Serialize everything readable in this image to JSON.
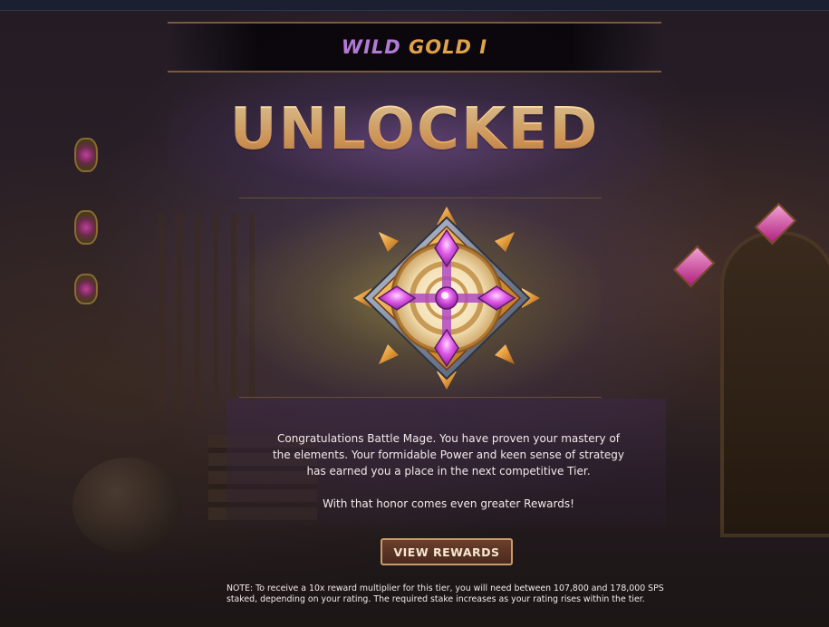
{
  "tier": {
    "league": "WILD",
    "rank": "GOLD I"
  },
  "unlock_title": "UNLOCKED",
  "message": {
    "paragraph1": "Congratulations Battle Mage. You have proven your mastery of the elements. Your formidable Power and keen sense of strategy has earned you a place in the next competitive Tier.",
    "paragraph2": "With that honor comes even greater Rewards!"
  },
  "view_rewards_label": "VIEW REWARDS",
  "note": "NOTE: To receive a 10x reward multiplier for this tier, you will need between 107,800 and 178,000 SPS staked, depending on your rating. The required stake increases as your rating rises within the tier.",
  "colors": {
    "accent_gold": "#e0a24a",
    "accent_purple": "#b27ad4",
    "gem_pink": "#d94be0"
  }
}
